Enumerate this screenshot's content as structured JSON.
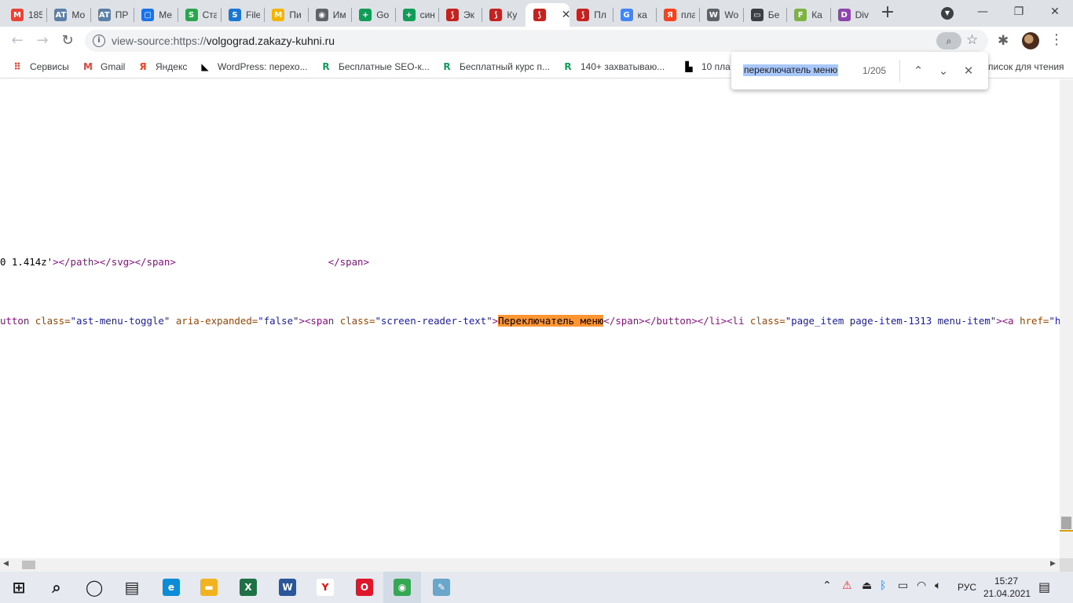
{
  "tabs": [
    {
      "title": "185",
      "icon": "gmail-icon",
      "color": "#ea4335",
      "glyph": "M"
    },
    {
      "title": "Мо",
      "icon": "advego-icon",
      "color": "#5b7fa6",
      "glyph": "AT"
    },
    {
      "title": "ПР",
      "icon": "advego-icon",
      "color": "#5b7fa6",
      "glyph": "AT"
    },
    {
      "title": "Ме",
      "icon": "messenger-icon",
      "color": "#1a73e8",
      "glyph": "▢"
    },
    {
      "title": "Ста",
      "icon": "stat-icon",
      "color": "#2ea44f",
      "glyph": "S"
    },
    {
      "title": "File",
      "icon": "file-icon",
      "color": "#1976d2",
      "glyph": "S"
    },
    {
      "title": "Пи",
      "icon": "mail-icon",
      "color": "#f4b400",
      "glyph": "M"
    },
    {
      "title": "Им",
      "icon": "globe-icon",
      "color": "#5f6368",
      "glyph": "◉"
    },
    {
      "title": "Go",
      "icon": "sheets-icon",
      "color": "#0f9d58",
      "glyph": "+"
    },
    {
      "title": "син",
      "icon": "sheets-icon",
      "color": "#0f9d58",
      "glyph": "+"
    },
    {
      "title": "Эк",
      "icon": "red-feather-icon",
      "color": "#c5221f",
      "glyph": "⟆"
    },
    {
      "title": "Ку",
      "icon": "red-feather-icon",
      "color": "#c5221f",
      "glyph": "⟆"
    },
    {
      "title": "",
      "icon": "red-feather-icon",
      "color": "#c5221f",
      "glyph": "⟆",
      "active": true
    },
    {
      "title": "Пл",
      "icon": "red-feather-icon",
      "color": "#c5221f",
      "glyph": "⟆"
    },
    {
      "title": "ка",
      "icon": "google-icon",
      "color": "#4285f4",
      "glyph": "G"
    },
    {
      "title": "пла",
      "icon": "yandex-icon",
      "color": "#fc3f1d",
      "glyph": "Я"
    },
    {
      "title": "Wo",
      "icon": "wordpress-icon",
      "color": "#5f6368",
      "glyph": "W"
    },
    {
      "title": "Бе",
      "icon": "book-icon",
      "color": "#3c4043",
      "glyph": "▭"
    },
    {
      "title": "Ка",
      "icon": "leaf-icon",
      "color": "#7cb342",
      "glyph": "F"
    },
    {
      "title": "Div",
      "icon": "divi-icon",
      "color": "#8e44ad",
      "glyph": "D"
    }
  ],
  "address": {
    "url_prefix": "view-source:https://",
    "url_domain": "volgograd.zakazy-kuhni.ru"
  },
  "bookmarks": [
    {
      "label": "Сервисы",
      "icon": "apps-grid-icon",
      "color": "#ea4335",
      "glyph": "⠿"
    },
    {
      "label": "Gmail",
      "icon": "gmail-icon",
      "color": "#ea4335",
      "glyph": "M"
    },
    {
      "label": "Яндекс",
      "icon": "yandex-icon",
      "color": "#fc3f1d",
      "glyph": "Я"
    },
    {
      "label": "WordPress: перехо...",
      "icon": "wordpress-flag-icon",
      "color": "#000000",
      "glyph": "◣"
    },
    {
      "label": "Бесплатные SEO-к...",
      "icon": "r-logo-icon",
      "color": "#0f9d58",
      "glyph": "R"
    },
    {
      "label": "Бесплатный курс п...",
      "icon": "r-logo-icon",
      "color": "#0f9d58",
      "glyph": "R"
    },
    {
      "label": "140+ захватываю...",
      "icon": "r-logo-icon",
      "color": "#0f9d58",
      "glyph": "R"
    },
    {
      "label": "10 пла",
      "icon": "building-icon",
      "color": "#000000",
      "glyph": "▙"
    },
    {
      "label": "писок для чтения",
      "icon": "reading-list-icon",
      "color": "#5f6368",
      "glyph": ""
    }
  ],
  "find": {
    "query": "переключатель меню",
    "count": "1/205"
  },
  "source": {
    "line1": {
      "p1": "0 1.414z'",
      "p2": "></path></svg></span>",
      "p3": "                          </span>"
    },
    "line2": {
      "t1": "utton ",
      "a1": "class=",
      "v1": "\"ast-menu-toggle\"",
      "a2": " aria-expanded=",
      "v2": "\"false\"",
      "t2": "><span ",
      "a3": "class=",
      "v3": "\"screen-reader-text\"",
      "t3": ">",
      "match": "Переключатель меню",
      "t4": "</span></button></li><li ",
      "a4": "class=",
      "v4": "\"page_item page-item-1313 menu-item\"",
      "t5": "><a ",
      "a5": "href=",
      "v5": "\"https://v"
    }
  },
  "taskbar": {
    "items": [
      {
        "name": "start-icon",
        "glyph": "⊞",
        "color": "#1f1f1f",
        "bg": "transparent"
      },
      {
        "name": "search-icon",
        "glyph": "⌕",
        "color": "#1f1f1f",
        "bg": "transparent"
      },
      {
        "name": "cortana-icon",
        "glyph": "◯",
        "color": "#1f1f1f",
        "bg": "transparent"
      },
      {
        "name": "task-view-icon",
        "glyph": "▤",
        "color": "#1f1f1f",
        "bg": "transparent"
      },
      {
        "name": "edge-icon",
        "glyph": "e",
        "color": "#ffffff",
        "bg": "#0c8bd6"
      },
      {
        "name": "file-explorer-icon",
        "glyph": "▬",
        "color": "#ffffff",
        "bg": "#f2b321"
      },
      {
        "name": "excel-icon",
        "glyph": "X",
        "color": "#ffffff",
        "bg": "#1e7145"
      },
      {
        "name": "word-icon",
        "glyph": "W",
        "color": "#ffffff",
        "bg": "#2b579a"
      },
      {
        "name": "yandex-browser-icon",
        "glyph": "Y",
        "color": "#ff0000",
        "bg": "#ffffff"
      },
      {
        "name": "opera-icon",
        "glyph": "O",
        "color": "#ffffff",
        "bg": "#e0162b"
      },
      {
        "name": "chrome-icon",
        "glyph": "◉",
        "color": "#ffffff",
        "bg": "#34a853"
      },
      {
        "name": "notepad-icon",
        "glyph": "✎",
        "color": "#ffffff",
        "bg": "#6aa6c9"
      }
    ],
    "lang": "РУС",
    "time": "15:27",
    "date": "21.04.2021"
  }
}
